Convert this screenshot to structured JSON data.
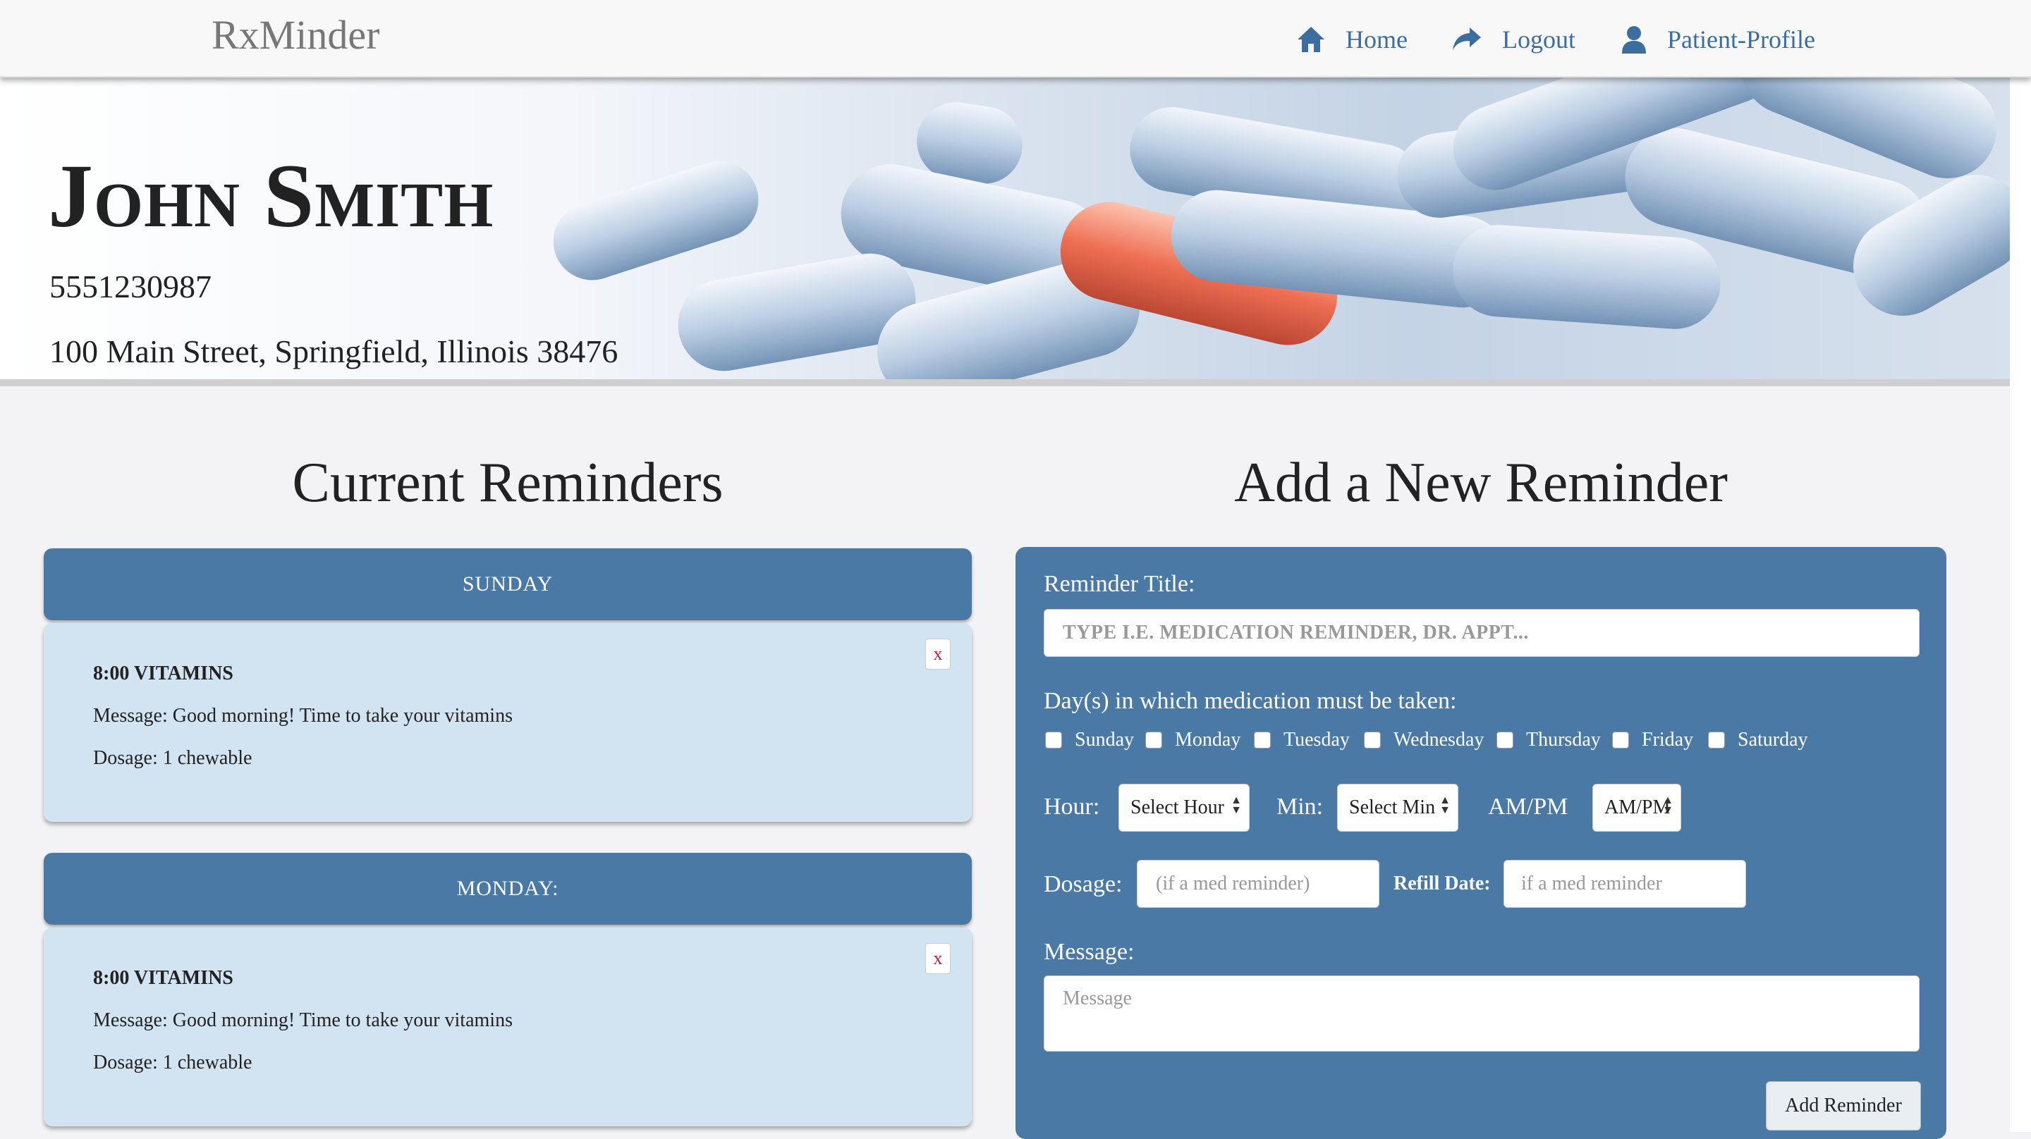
{
  "navbar": {
    "brand": "RxMinder",
    "links": [
      {
        "label": "Home",
        "icon": "home-icon"
      },
      {
        "label": "Logout",
        "icon": "share-arrow-icon"
      },
      {
        "label": "Patient-Profile",
        "icon": "user-icon"
      }
    ]
  },
  "patient": {
    "name": "John Smith",
    "phone": "5551230987",
    "address": "100 Main Street, Springfield, Illinois 38476"
  },
  "current_reminders": {
    "title": "Current Reminders",
    "days": [
      {
        "day": "SUNDAY",
        "title": "8:00 VITAMINS",
        "message": "Message: Good morning! Time to take your vitamins",
        "dosage": "Dosage: 1 chewable",
        "delete_label": "x"
      },
      {
        "day": "MONDAY:",
        "title": "8:00 VITAMINS",
        "message": "Message: Good morning! Time to take your vitamins",
        "dosage": "Dosage: 1 chewable",
        "delete_label": "x"
      }
    ]
  },
  "new_reminder": {
    "title": "Add a New Reminder",
    "reminder_title_label": "Reminder Title:",
    "reminder_title_placeholder": "TYPE I.E. MEDICATION REMINDER, DR. APPT...",
    "days_label": "Day(s) in which medication must be taken:",
    "days": [
      "Sunday",
      "Monday",
      "Tuesday",
      "Wednesday",
      "Thursday",
      "Friday",
      "Saturday"
    ],
    "hour_label": "Hour:",
    "hour_select": "Select Hour",
    "min_label": "Min:",
    "min_select": "Select Min",
    "ampm_label": "AM/PM",
    "ampm_select": "AM/PM",
    "dosage_label": "Dosage:",
    "dosage_placeholder": "(if a med reminder)",
    "refill_label": "Refill Date:",
    "refill_placeholder": "if a med reminder",
    "message_label": "Message:",
    "message_placeholder": "Message",
    "submit_label": "Add Reminder"
  },
  "colors": {
    "accent": "#4a79a5",
    "card": "#d2e3f1",
    "link": "#3b6e9e",
    "pill_highlight": "#ee6a4a"
  }
}
